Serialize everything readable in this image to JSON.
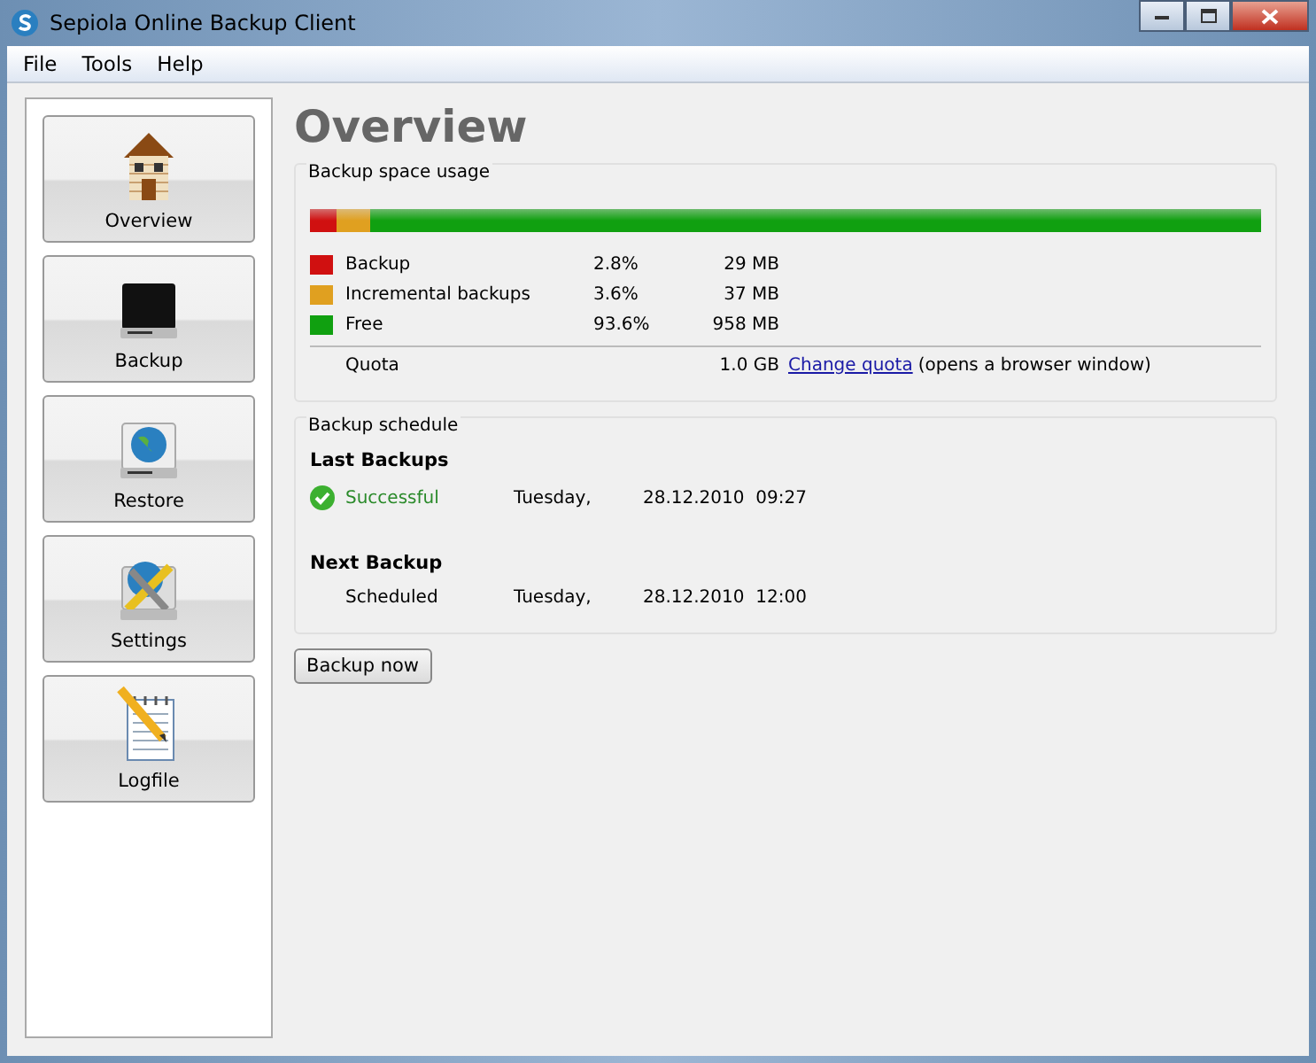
{
  "window": {
    "title": "Sepiola Online Backup Client"
  },
  "menu": [
    "File",
    "Tools",
    "Help"
  ],
  "sidebar": {
    "items": [
      {
        "label": "Overview",
        "kind": "house"
      },
      {
        "label": "Backup",
        "kind": "drive"
      },
      {
        "label": "Restore",
        "kind": "restore"
      },
      {
        "label": "Settings",
        "kind": "settings"
      },
      {
        "label": "Logfile",
        "kind": "log"
      }
    ]
  },
  "heading": "Overview",
  "space_usage": {
    "title": "Backup space usage",
    "items": [
      {
        "name": "Backup",
        "percent": "2.8%",
        "size": "29 MB",
        "level": 0.028,
        "color": "#d01010"
      },
      {
        "name": "Incremental backups",
        "percent": "3.6%",
        "size": "37 MB",
        "level": 0.036,
        "color": "#e0a020"
      },
      {
        "name": "Free",
        "percent": "93.6%",
        "size": "958 MB",
        "level": 0.936,
        "color": "#10a010"
      }
    ],
    "quota": {
      "label": "Quota",
      "value": "1.0 GB",
      "link": "Change quota",
      "note": "(opens a browser window)"
    }
  },
  "schedule": {
    "title": "Backup schedule",
    "sections": [
      {
        "heading": "Last Backups",
        "status": "Successful",
        "kind": "success",
        "day": "Tuesday,",
        "date": "28.12.2010",
        "time": "09:27"
      },
      {
        "heading": "Next Backup",
        "status": "Scheduled",
        "kind": "scheduled",
        "day": "Tuesday,",
        "date": "28.12.2010",
        "time": "12:00"
      }
    ]
  },
  "button": "Backup now"
}
